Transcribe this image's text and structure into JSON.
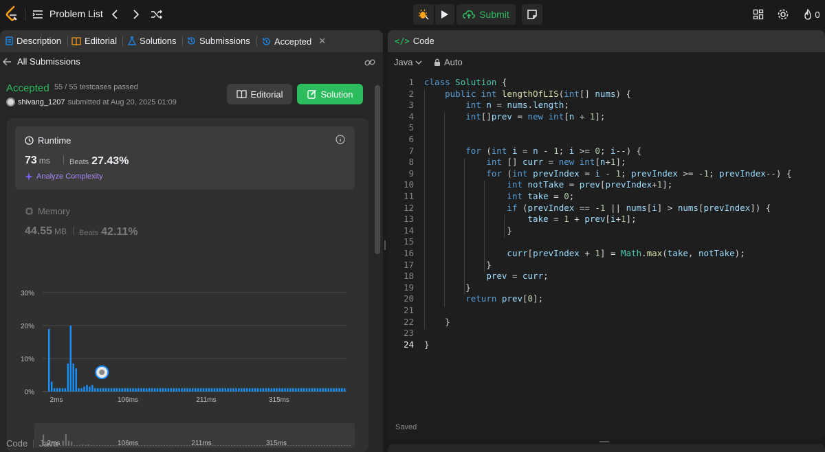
{
  "topbar": {
    "problem_list": "Problem List",
    "submit": "Submit",
    "streak": "0"
  },
  "tabs": {
    "description": "Description",
    "editorial": "Editorial",
    "solutions": "Solutions",
    "submissions": "Submissions",
    "accepted": "Accepted"
  },
  "subnav": {
    "all_submissions": "All Submissions"
  },
  "result": {
    "status": "Accepted",
    "testcases": "55 / 55 testcases passed",
    "user": "shivang_1207",
    "submitted_text": "submitted at Aug 20, 2025 01:09",
    "editorial_btn": "Editorial",
    "solution_btn": "Solution"
  },
  "runtime": {
    "label": "Runtime",
    "value": "73",
    "unit": "ms",
    "beats_label": "Beats",
    "beats_value": "27.43%",
    "analyze": "Analyze Complexity"
  },
  "memory": {
    "label": "Memory",
    "value": "44.55",
    "unit": "MB",
    "beats_label": "Beats",
    "beats_value": "42.11%"
  },
  "chart_data": {
    "type": "bar",
    "yticks": [
      "30%",
      "20%",
      "10%",
      "0%"
    ],
    "ylim": [
      0,
      30
    ],
    "xticks": [
      "2ms",
      "106ms",
      "211ms",
      "315ms"
    ],
    "values": [
      19,
      3,
      1,
      1,
      1,
      1,
      1,
      8.5,
      20,
      8.5,
      7,
      1,
      1,
      1.5,
      2,
      1.5,
      2,
      1,
      1,
      1,
      1,
      1,
      1,
      1,
      1,
      1,
      1,
      1,
      1,
      1,
      1,
      1,
      1,
      1,
      1,
      1,
      1,
      1,
      1,
      1,
      1,
      1,
      1,
      1,
      1,
      1,
      1,
      1,
      1,
      1,
      1,
      1,
      1,
      1,
      1,
      1,
      1,
      1,
      1,
      1,
      1,
      1,
      1,
      1,
      1,
      1,
      1,
      1,
      1,
      1,
      1,
      1,
      1,
      1,
      1,
      1,
      1,
      1,
      1,
      1,
      1,
      1,
      1,
      1,
      1,
      1,
      1,
      1,
      1,
      1,
      1,
      1,
      1,
      1,
      1,
      1,
      1,
      1,
      1,
      1,
      1,
      1,
      1,
      1,
      1,
      1,
      1,
      1,
      1,
      1
    ],
    "mini_xticks": [
      "2ms",
      "106ms",
      "211ms",
      "315ms"
    ],
    "bar_color": "#1a90ff",
    "marker_index": 18
  },
  "footer": {
    "code": "Code",
    "lang": "Java"
  },
  "editor": {
    "title": "Code",
    "language": "Java",
    "mode": "Auto",
    "saved": "Saved",
    "current_line": 24,
    "lines": [
      "class Solution {",
      "    public int lengthOfLIS(int[] nums) {",
      "        int n = nums.length;",
      "        int[]prev = new int[n + 1];",
      "",
      "",
      "        for (int i = n - 1; i >= 0; i--) {",
      "            int [] curr = new int[n+1];",
      "            for (int prevIndex = i - 1; prevIndex >= -1; prevIndex--) {",
      "                int notTake = prev[prevIndex+1];",
      "                int take = 0;",
      "                if (prevIndex == -1 || nums[i] > nums[prevIndex]) {",
      "                    take = 1 + prev[i+1];",
      "                }",
      "",
      "                curr[prevIndex + 1] = Math.max(take, notTake);",
      "            }",
      "            prev = curr;",
      "        }",
      "        return prev[0];",
      "",
      "    }",
      "",
      "}"
    ]
  },
  "colors": {
    "accent_green": "#2cbb5d",
    "accent_blue": "#1a90ff",
    "purple": "#a989f4"
  }
}
